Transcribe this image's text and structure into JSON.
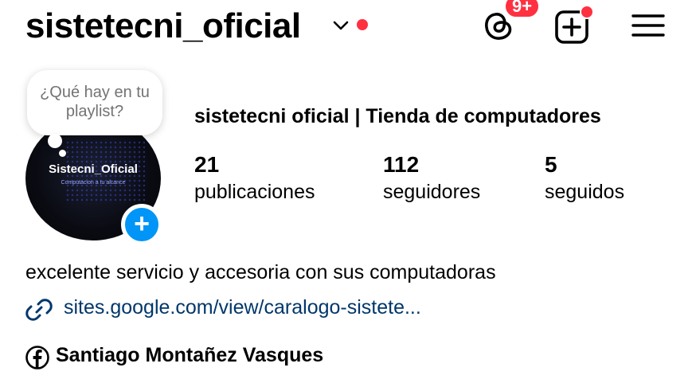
{
  "header": {
    "username": "sistetecni_oficial",
    "threads_badge": "9+"
  },
  "note": {
    "text": "¿Qué hay en tu playlist?"
  },
  "avatar": {
    "title": "Sistecni_Oficial",
    "subtitle": "Computacion a tu alcance"
  },
  "profile": {
    "display_name": "sistetecni oficial | Tienda de computadores",
    "stats": [
      {
        "value": "21",
        "label": "publicaciones"
      },
      {
        "value": "112",
        "label": "seguidores"
      },
      {
        "value": "5",
        "label": "seguidos"
      }
    ],
    "bio": "excelente servicio y accesoria con sus computadoras",
    "link": "sites.google.com/view/caralogo-sistete...",
    "facebook_name": "Santiago Montañez Vasques"
  },
  "colors": {
    "notification": "#ff3040",
    "primary_blue": "#0095f6",
    "link": "#00376b"
  }
}
